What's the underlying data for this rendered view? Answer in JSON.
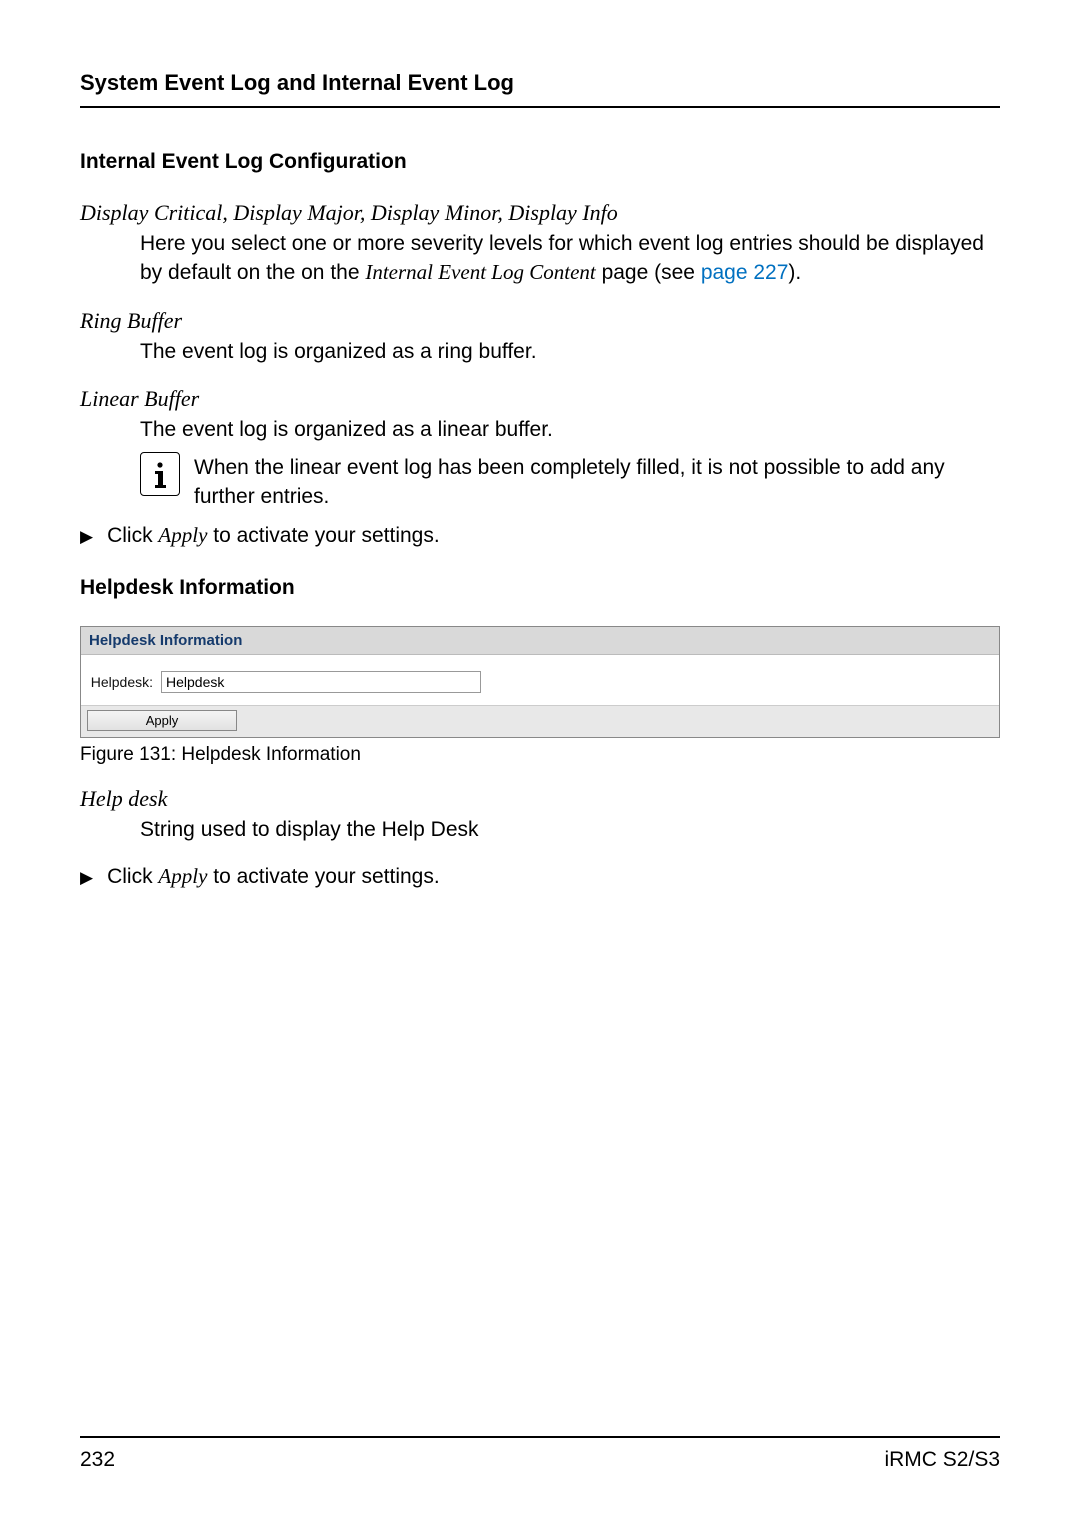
{
  "header": {
    "running_title": "System Event Log and Internal Event Log"
  },
  "section1": {
    "heading": "Internal Event Log Configuration",
    "severity_line": "Display Critical, Display Major, Display Minor, Display Info",
    "severity_desc_pre": "Here you select one or more severity levels for which event log entries should be displayed by default on the on the ",
    "severity_desc_italic": "Internal Event Log Content",
    "severity_desc_post1": " page (see ",
    "severity_desc_link": "page 227",
    "severity_desc_post2": ").",
    "ring_label": "Ring Buffer",
    "ring_desc": "The event log is organized as a ring buffer.",
    "linear_label": "Linear Buffer",
    "linear_desc": "The event log is organized as a linear buffer.",
    "note": "When the linear event log has been completely filled, it is not possible to add any further entries.",
    "apply_pre": "Click ",
    "apply_italic": "Apply",
    "apply_post": " to activate your settings."
  },
  "section2": {
    "heading": "Helpdesk Information",
    "figure": {
      "panel_title": "Helpdesk Information",
      "field_label": "Helpdesk:",
      "field_value": "Helpdesk",
      "apply_label": "Apply",
      "caption": "Figure 131: Helpdesk Information"
    },
    "helpdesk_term": "Help desk",
    "helpdesk_desc": "String used to display the Help Desk",
    "apply_pre": "Click ",
    "apply_italic": "Apply",
    "apply_post": " to activate your settings."
  },
  "footer": {
    "page_number": "232",
    "doc_id": "iRMC S2/S3"
  }
}
